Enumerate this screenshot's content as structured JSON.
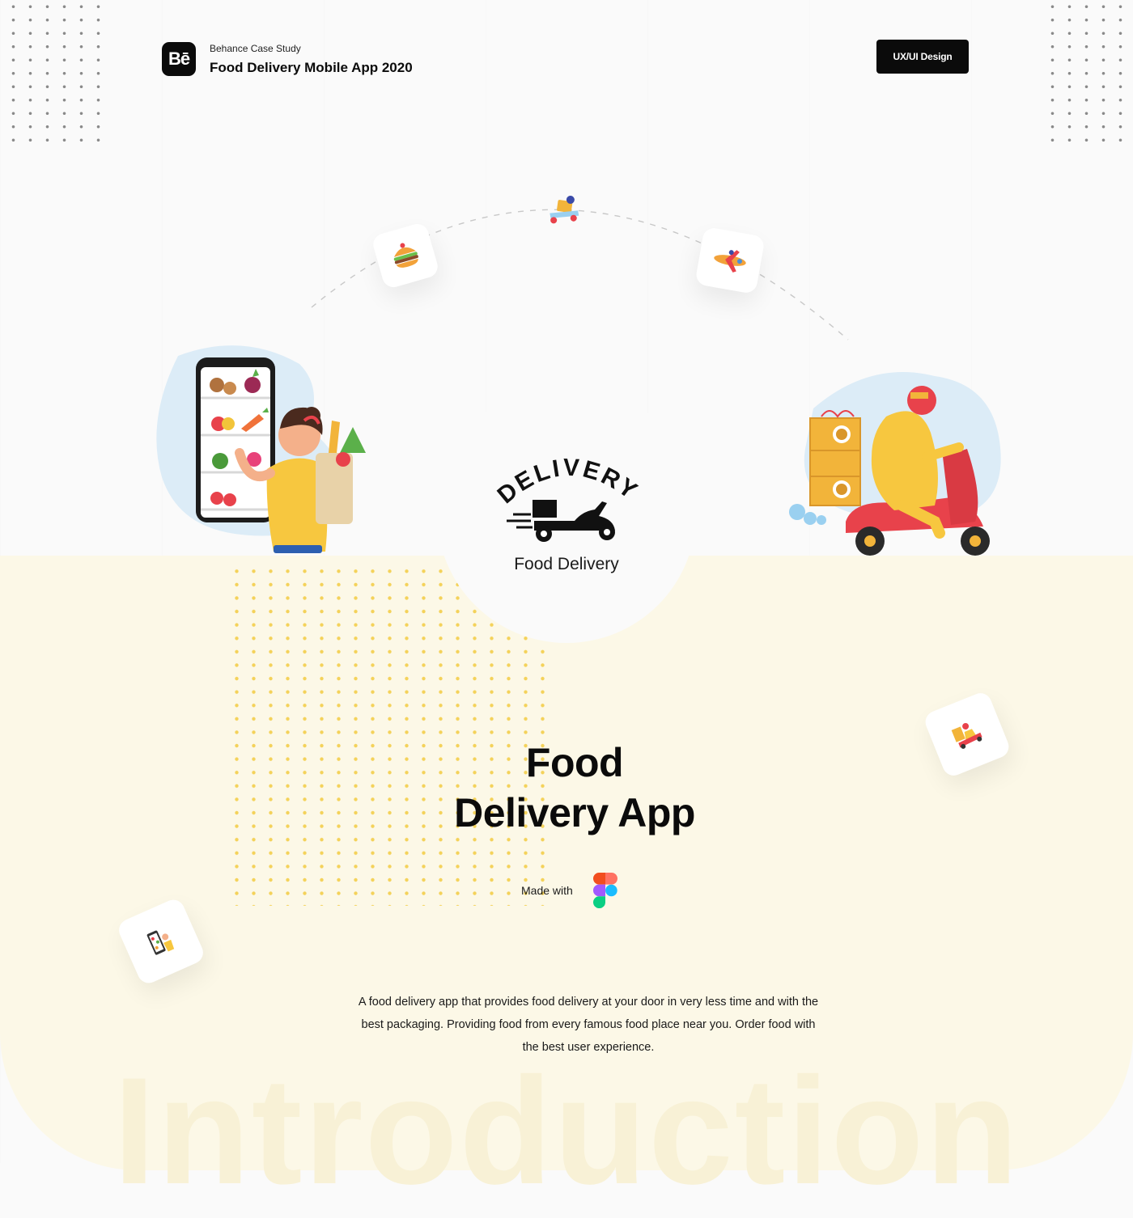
{
  "header": {
    "logo_text": "Bē",
    "kicker": "Behance Case Study",
    "title": "Food Delivery Mobile App 2020",
    "tag_button": "UX/UI Design"
  },
  "badge": {
    "arc_text": "DELIVERY",
    "subtitle": "Food Delivery"
  },
  "hero": {
    "title_line1": "Food",
    "title_line2": "Delivery App",
    "made_with": "Made with"
  },
  "description": "A food delivery app that provides food delivery at your door in very less time and with the best packaging. Providing food from every famous food place near you. Order food with the best user experience.",
  "background_word": "Introduction",
  "icons": {
    "brand": "behance-logo",
    "tool": "figma-icon",
    "floating": [
      "burger-icon",
      "delivery-rider-icon",
      "airplane-icon",
      "scooter-box-icon",
      "phone-shopping-icon"
    ]
  },
  "colors": {
    "accent_yellow": "#fcf8e7",
    "dot_yellow": "#f4d25a",
    "dark": "#0b0b0b",
    "scooter_red": "#e8424b",
    "rider_yellow": "#f7c73f",
    "box_orange": "#f2b43a",
    "blob_blue": "#dcecf7"
  }
}
